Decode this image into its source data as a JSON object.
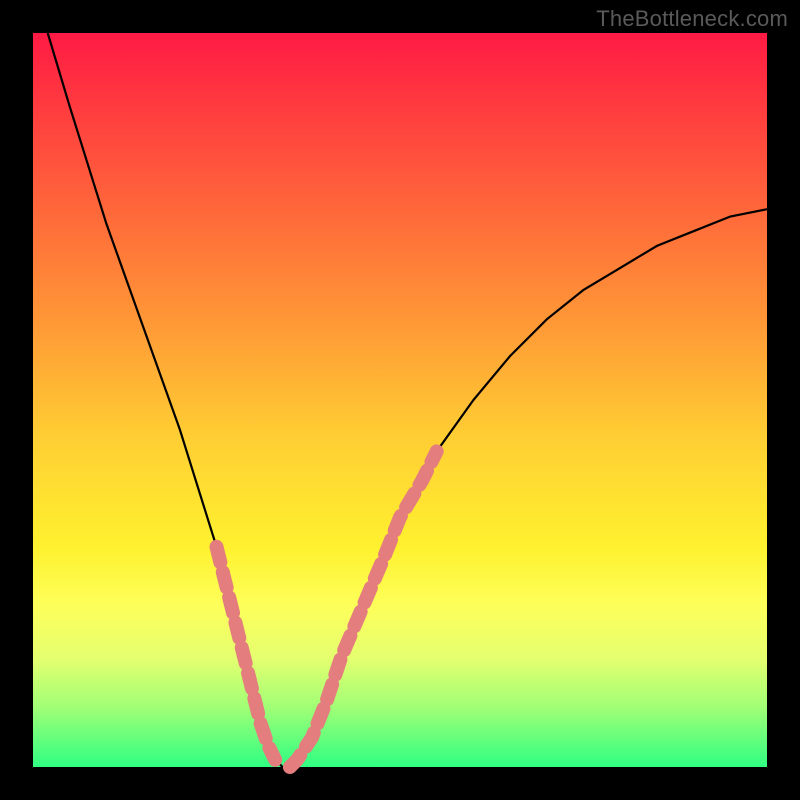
{
  "watermark": "TheBottleneck.com",
  "chart_data": {
    "type": "line",
    "title": "",
    "xlabel": "",
    "ylabel": "",
    "xlim": [
      0,
      100
    ],
    "ylim": [
      0,
      100
    ],
    "grid": false,
    "series": [
      {
        "name": "bottleneck-curve",
        "color": "#000000",
        "x": [
          2,
          5,
          10,
          15,
          20,
          25,
          28,
          30,
          31,
          32,
          33,
          34,
          35,
          36,
          38,
          40,
          45,
          50,
          55,
          60,
          65,
          70,
          75,
          80,
          85,
          90,
          95,
          100
        ],
        "y": [
          100,
          90,
          74,
          60,
          46,
          30,
          18,
          10,
          6,
          3,
          1,
          0,
          0,
          1,
          4,
          9,
          22,
          34,
          43,
          50,
          56,
          61,
          65,
          68,
          71,
          73,
          75,
          76
        ]
      }
    ],
    "highlight_segments": [
      {
        "name": "left-highlight",
        "color": "#e47d7d",
        "x": [
          25,
          26,
          27,
          28,
          29,
          30,
          31,
          32,
          33
        ],
        "y": [
          30,
          26,
          22,
          18,
          14,
          10,
          6,
          3,
          1
        ]
      },
      {
        "name": "right-highlight",
        "color": "#e47d7d",
        "x": [
          35,
          36,
          38,
          40,
          42,
          45,
          48,
          50,
          53,
          55
        ],
        "y": [
          0,
          1,
          4,
          9,
          15,
          22,
          29,
          34,
          39,
          43
        ]
      }
    ]
  }
}
